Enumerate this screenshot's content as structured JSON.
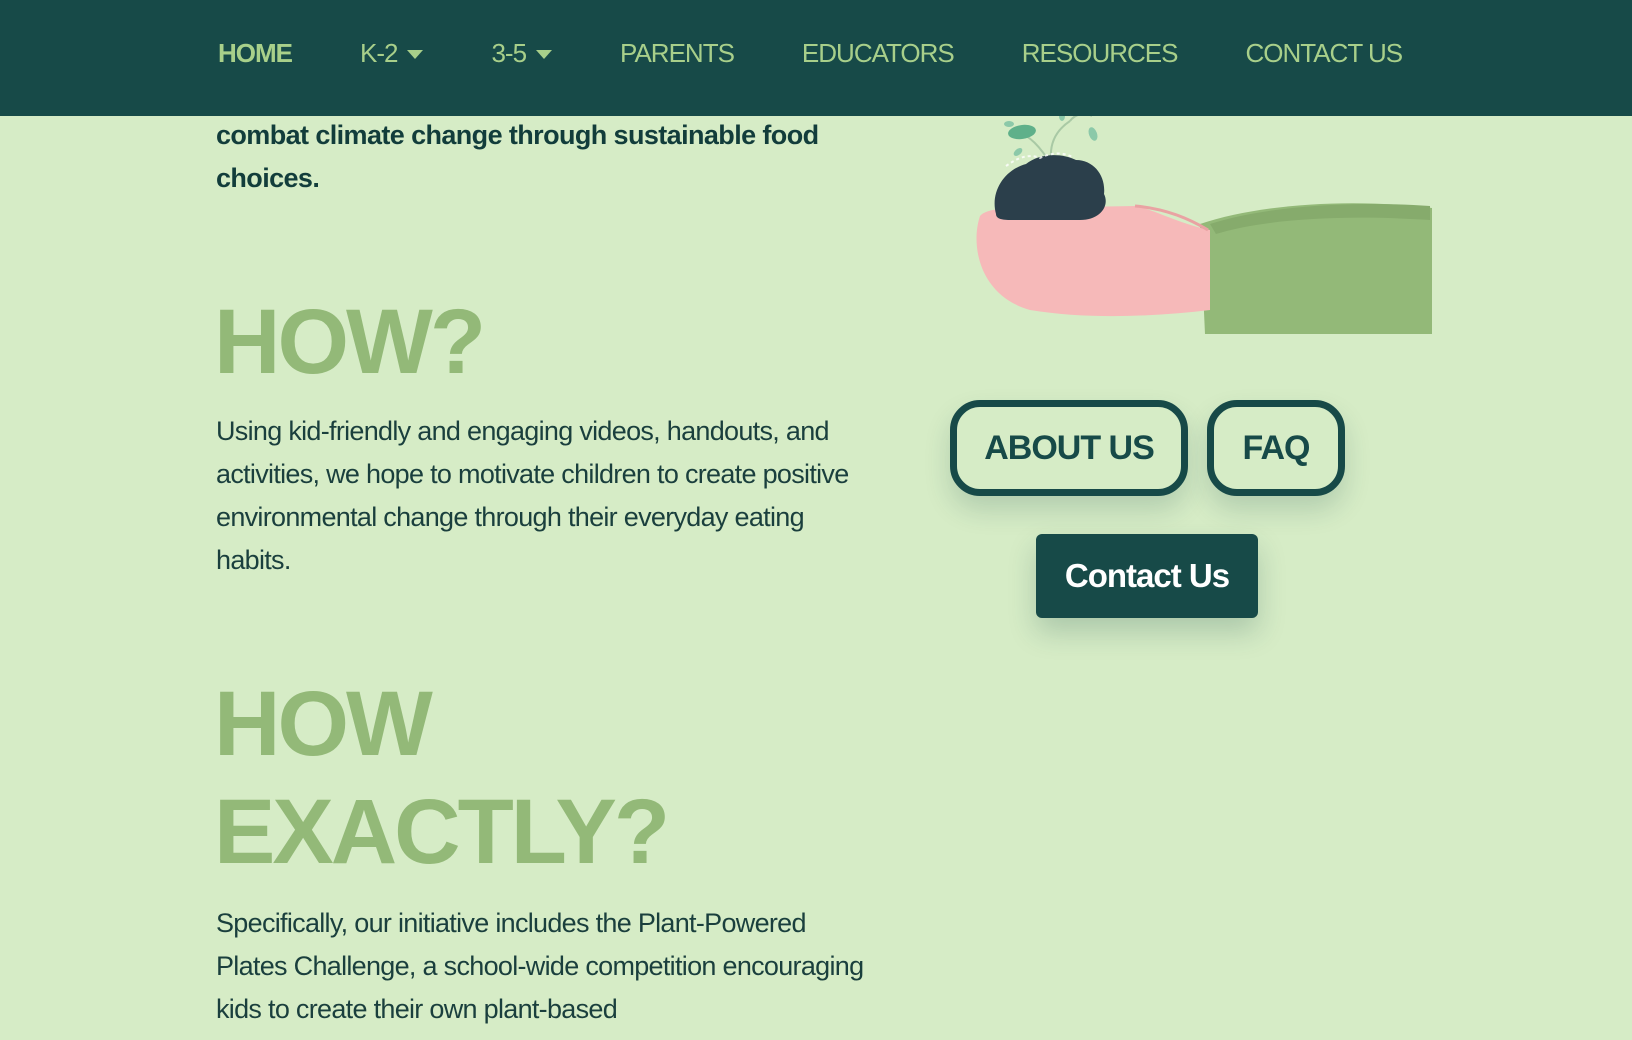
{
  "nav": {
    "items": [
      {
        "label": "HOME",
        "active": true,
        "dropdown": false
      },
      {
        "label": "K-2",
        "active": false,
        "dropdown": true
      },
      {
        "label": "3-5",
        "active": false,
        "dropdown": true
      },
      {
        "label": "PARENTS",
        "active": false,
        "dropdown": false
      },
      {
        "label": "EDUCATORS",
        "active": false,
        "dropdown": false
      },
      {
        "label": "RESOURCES",
        "active": false,
        "dropdown": false
      },
      {
        "label": "CONTACT US",
        "active": false,
        "dropdown": false
      }
    ]
  },
  "main": {
    "intro_tail": "combat climate change through sustainable food choices.",
    "sections": [
      {
        "heading": "HOW?",
        "body": "Using kid-friendly and engaging videos, handouts, and activities, we hope to motivate children to create positive environmental change through their everyday eating habits."
      },
      {
        "heading": "HOW EXACTLY?",
        "body": "Specifically, our initiative includes the Plant-Powered Plates Challenge, a school-wide competition encouraging kids to create their own plant-based"
      }
    ]
  },
  "aside": {
    "illustration_icon": "hand-holding-seedling-icon",
    "about_label": "ABOUT US",
    "faq_label": "FAQ",
    "contact_label": "Contact Us"
  },
  "colors": {
    "background": "#d6ecc6",
    "navbar": "#174a48",
    "nav_text": "#a8cf8a",
    "heading_green": "#93b978",
    "dark_text": "#123d3b",
    "button_dark": "#174a48",
    "skin_pink": "#f6b9b9",
    "sleeve_green": "#93b978",
    "soil_dark": "#2b3f4b",
    "leaf_teal": "#5fb08a"
  }
}
